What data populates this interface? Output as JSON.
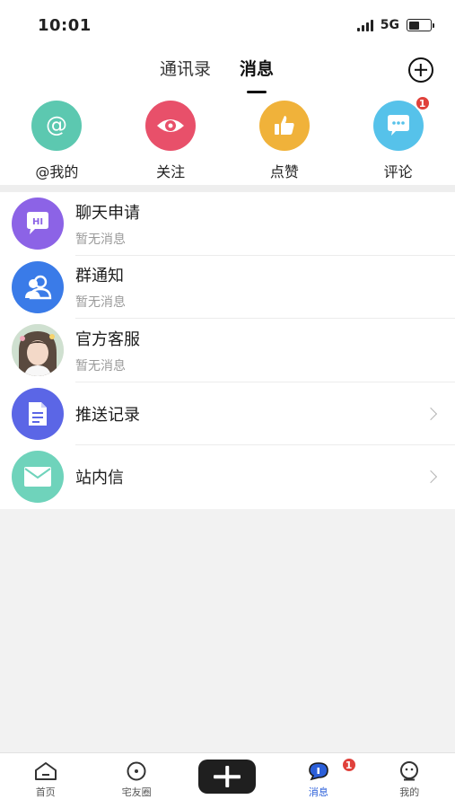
{
  "status_bar": {
    "time": "10:01",
    "network": "5G"
  },
  "header": {
    "tabs": [
      {
        "label": "通讯录",
        "active": false
      },
      {
        "label": "消息",
        "active": true
      }
    ]
  },
  "quick_actions": [
    {
      "label": "@我的",
      "icon": "at-icon",
      "color": "#5cc8b0"
    },
    {
      "label": "关注",
      "icon": "eye-icon",
      "color": "#e8506a"
    },
    {
      "label": "点赞",
      "icon": "thumbs-up-icon",
      "color": "#f0b23a"
    },
    {
      "label": "评论",
      "icon": "comment-icon",
      "color": "#56c2ea",
      "badge": "1"
    }
  ],
  "messages": [
    {
      "title": "聊天申请",
      "subtitle": "暂无消息",
      "icon": "chat-hi-icon",
      "color": "#8c63e6"
    },
    {
      "title": "群通知",
      "subtitle": "暂无消息",
      "icon": "group-icon",
      "color": "#3a7be8"
    },
    {
      "title": "官方客服",
      "subtitle": "暂无消息",
      "icon": "service-avatar",
      "color": "#d9c2b0"
    },
    {
      "title": "推送记录",
      "subtitle": "",
      "icon": "document-icon",
      "color": "#5b66e6",
      "chevron": true
    },
    {
      "title": "站内信",
      "subtitle": "",
      "icon": "mail-icon",
      "color": "#6fd3bb",
      "chevron": true
    }
  ],
  "bottom_nav": [
    {
      "label": "首页",
      "icon": "home-icon",
      "active": false
    },
    {
      "label": "宅友圈",
      "icon": "circle-dot-icon",
      "active": false
    },
    {
      "label": "",
      "icon": "plus-icon",
      "active": false
    },
    {
      "label": "消息",
      "icon": "message-icon",
      "active": true,
      "badge": "1"
    },
    {
      "label": "我的",
      "icon": "profile-icon",
      "active": false
    }
  ],
  "colors": {
    "accent": "#2b5fd9",
    "badge": "#e0413b"
  }
}
